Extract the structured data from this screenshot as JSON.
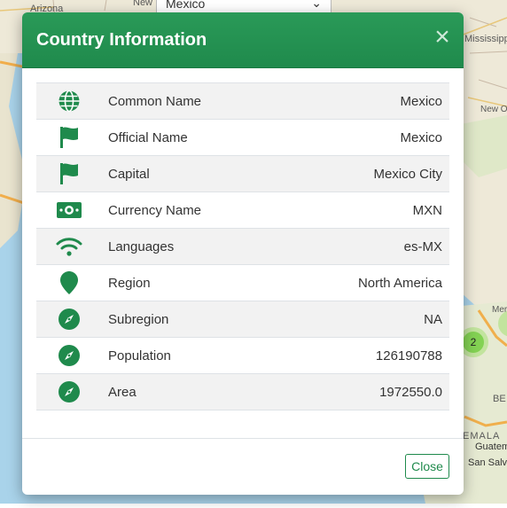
{
  "map": {
    "labels": {
      "arizona": "Arizona",
      "mississippi": "Mississippi",
      "new_top": "New",
      "new_orleans": "New O",
      "mer": "Mer",
      "bel": "BE",
      "temala": "EMALA",
      "guatemala": "Guatemal",
      "san_salvador": "San Salv"
    },
    "country_select": {
      "value": "Mexico"
    },
    "cluster_count": "2"
  },
  "modal": {
    "title": "Country Information",
    "close_symbol": "×",
    "rows": [
      {
        "icon": "globe-icon",
        "label": "Common Name",
        "value": "Mexico"
      },
      {
        "icon": "flag-icon",
        "label": "Official Name",
        "value": "Mexico"
      },
      {
        "icon": "flag-icon",
        "label": "Capital",
        "value": "Mexico City"
      },
      {
        "icon": "money-bill-icon",
        "label": "Currency Name",
        "value": "MXN"
      },
      {
        "icon": "wifi-icon",
        "label": "Languages",
        "value": "es-MX"
      },
      {
        "icon": "map-marker-icon",
        "label": "Region",
        "value": "North America"
      },
      {
        "icon": "compass-icon",
        "label": "Subregion",
        "value": "NA"
      },
      {
        "icon": "compass-icon",
        "label": "Population",
        "value": "126190788"
      },
      {
        "icon": "compass-icon",
        "label": "Area",
        "value": "1972550.0"
      }
    ],
    "footer": {
      "close_label": "Close"
    }
  },
  "colors": {
    "accent": "#1f8a4c",
    "header": "#2a9a58",
    "row_stripe": "#f2f2f2"
  }
}
